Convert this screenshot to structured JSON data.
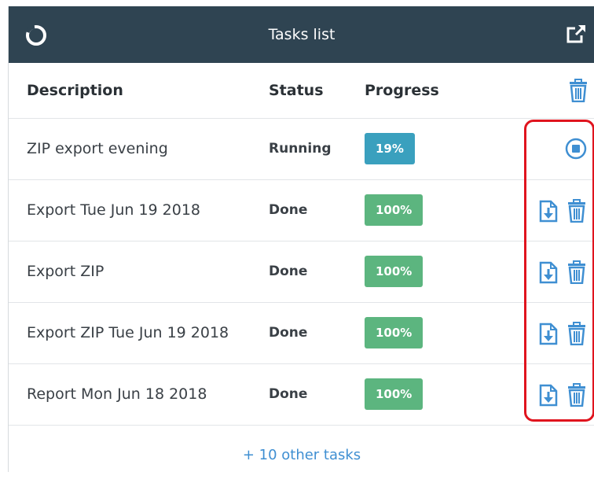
{
  "header": {
    "title": "Tasks list",
    "logo_icon": "circle-logo-icon",
    "popout_icon": "external-link-icon"
  },
  "table": {
    "columns": {
      "description": "Description",
      "status": "Status",
      "progress": "Progress"
    },
    "header_action_icon": "trash-icon",
    "rows": [
      {
        "description": "ZIP export evening",
        "status": "Running",
        "progress": "19%",
        "progress_value": 0.19,
        "actions": [
          "stop-icon"
        ]
      },
      {
        "description": "Export Tue Jun 19 2018",
        "status": "Done",
        "progress": "100%",
        "progress_value": 1.0,
        "actions": [
          "download-icon",
          "trash-icon"
        ]
      },
      {
        "description": "Export ZIP",
        "status": "Done",
        "progress": "100%",
        "progress_value": 1.0,
        "actions": [
          "download-icon",
          "trash-icon"
        ]
      },
      {
        "description": "Export ZIP Tue Jun 19 2018",
        "status": "Done",
        "progress": "100%",
        "progress_value": 1.0,
        "actions": [
          "download-icon",
          "trash-icon"
        ]
      },
      {
        "description": "Report Mon Jun 18 2018",
        "status": "Done",
        "progress": "100%",
        "progress_value": 1.0,
        "actions": [
          "download-icon",
          "trash-icon"
        ]
      }
    ]
  },
  "footer": {
    "more_link": "+ 10 other tasks"
  },
  "colors": {
    "header_bg": "#2f4452",
    "done": "#5cb57f",
    "running": "#3aa0be",
    "icon_blue": "#3f8fd2",
    "highlight": "#e0141e"
  }
}
